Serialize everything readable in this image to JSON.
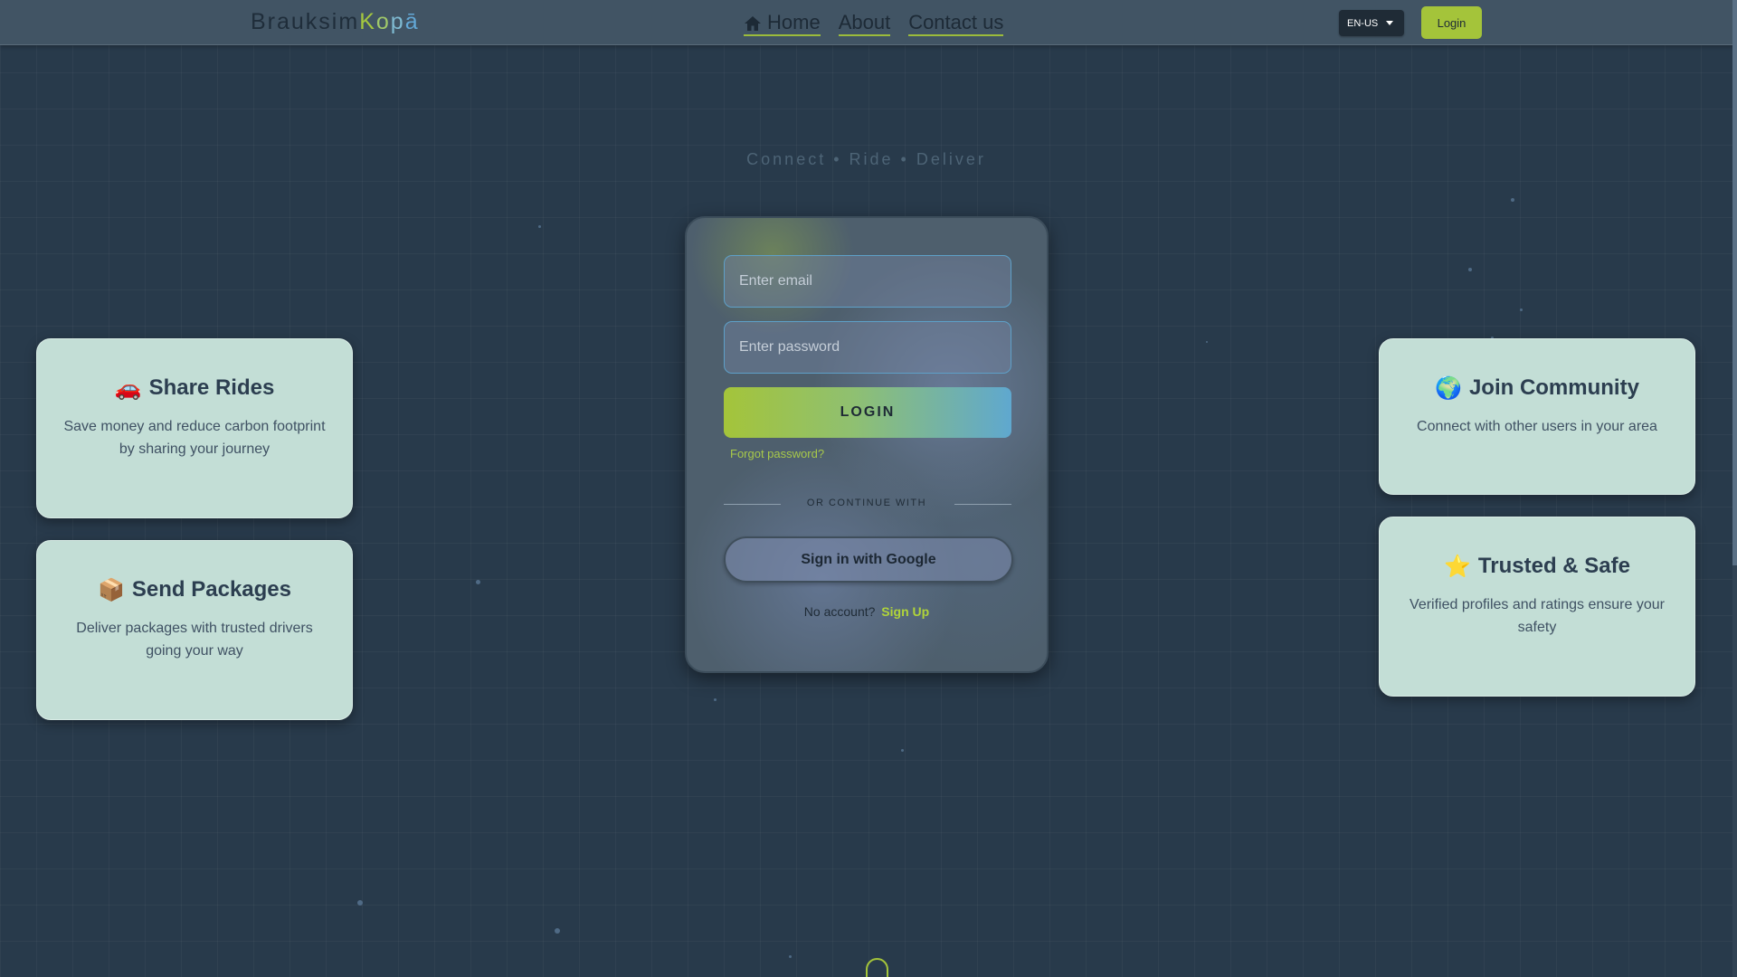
{
  "navbar": {
    "brand_prefix": "Brauksim",
    "brand_suffix": [
      "K",
      "o",
      "p",
      "ā"
    ],
    "links": [
      {
        "label": "Home",
        "icon": "home-icon"
      },
      {
        "label": "About"
      },
      {
        "label": "Contact us"
      }
    ],
    "language": "EN-US",
    "login_label": "Login"
  },
  "tagline": "Connect • Ride • Deliver",
  "login_form": {
    "email_placeholder": "Enter email",
    "password_placeholder": "Enter password",
    "submit_label": "LOGIN",
    "forgot_label": "Forgot password?",
    "divider_label": "OR CONTINUE WITH",
    "google_label": "Sign in with Google",
    "no_account_label": "No account?",
    "signup_label": "Sign Up"
  },
  "features": {
    "share": {
      "icon": "🚗",
      "title": "Share Rides",
      "desc": "Save money and reduce carbon footprint by sharing your journey"
    },
    "send": {
      "icon": "📦",
      "title": "Send Packages",
      "desc": "Deliver packages with trusted drivers going your way"
    },
    "join": {
      "icon": "🌍",
      "title": "Join Community",
      "desc": "Connect with other users in your area"
    },
    "trust": {
      "icon": "⭐",
      "title": "Trusted & Safe",
      "desc": "Verified profiles and ratings ensure your safety"
    }
  },
  "colors": {
    "accent_green": "#a4c43a",
    "accent_blue": "#5fa8cf",
    "background": "#283a4b",
    "card": "#c3ded6"
  }
}
